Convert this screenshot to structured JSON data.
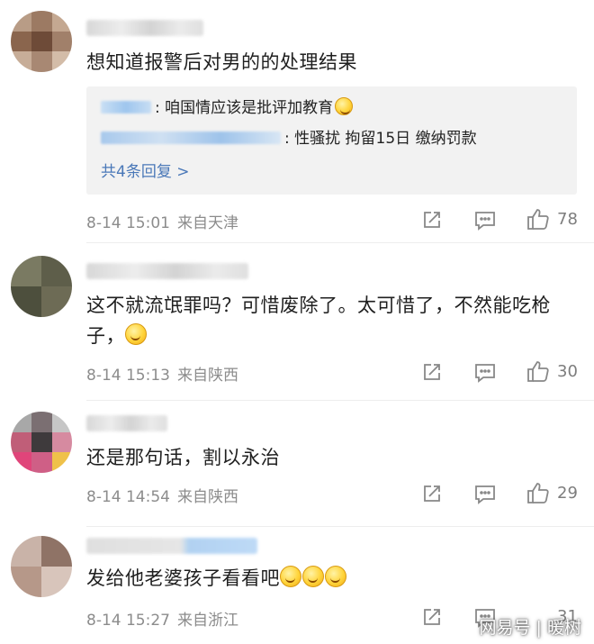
{
  "comments": [
    {
      "text": "想知道报警后对男的的处理结果",
      "replies": [
        {
          "text": ": 咱国情应该是批评加教育"
        },
        {
          "text": ": 性骚扰 拘留15日 缴纳罚款"
        }
      ],
      "more_replies": "共4条回复 >",
      "date": "8-14 15:01",
      "source": "来自天津",
      "likes": "78"
    },
    {
      "text": "这不就流氓罪吗？可惜废除了。太可惜了，不然能吃枪子，",
      "date": "8-14 15:13",
      "source": "来自陕西",
      "likes": "30"
    },
    {
      "text": "还是那句话，割以永治",
      "date": "8-14 14:54",
      "source": "来自陕西",
      "likes": "29"
    },
    {
      "text": "发给他老婆孩子看看吧",
      "date": "8-14 15:27",
      "source": "来自浙江",
      "likes": "31"
    }
  ],
  "icons": [
    "share-icon",
    "comment-icon",
    "like-icon",
    "grin-emoji",
    "laugh-cry-emoji",
    "smile-emoji"
  ],
  "watermark": "网易号 | 暖树",
  "colors": {
    "link": "#4a78b8",
    "meta": "#8c8c8c",
    "reply_bg": "#f2f2f2"
  }
}
